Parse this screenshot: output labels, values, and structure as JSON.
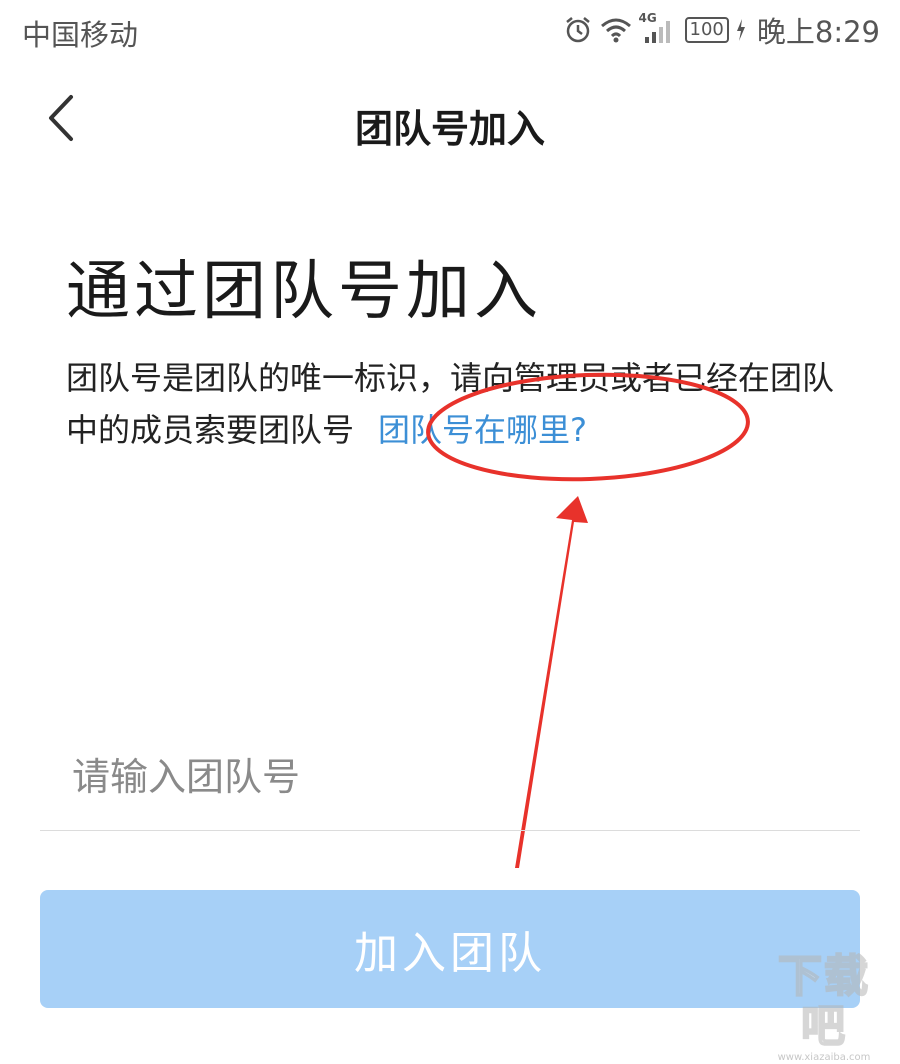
{
  "status_bar": {
    "carrier": "中国移动",
    "network": "4G",
    "battery": "100",
    "time": "晚上8:29",
    "icons": [
      "alarm-icon",
      "wifi-icon",
      "signal-icon",
      "battery-icon",
      "charging-icon"
    ]
  },
  "nav": {
    "back_icon": "chevron-left-icon",
    "title": "团队号加入"
  },
  "main": {
    "heading": "通过团队号加入",
    "description": "团队号是团队的唯一标识，请向管理员或者已经在团队中的成员索要团队号",
    "help_link": "团队号在哪里?"
  },
  "form": {
    "input_placeholder": "请输入团队号",
    "input_value": "",
    "join_button": "加入团队"
  },
  "watermark": {
    "logo": "下载吧",
    "url": "www.xiazaiba.com"
  },
  "colors": {
    "link": "#3c8fd6",
    "button_disabled": "#a7d0f7",
    "annotation": "#e8322b"
  }
}
